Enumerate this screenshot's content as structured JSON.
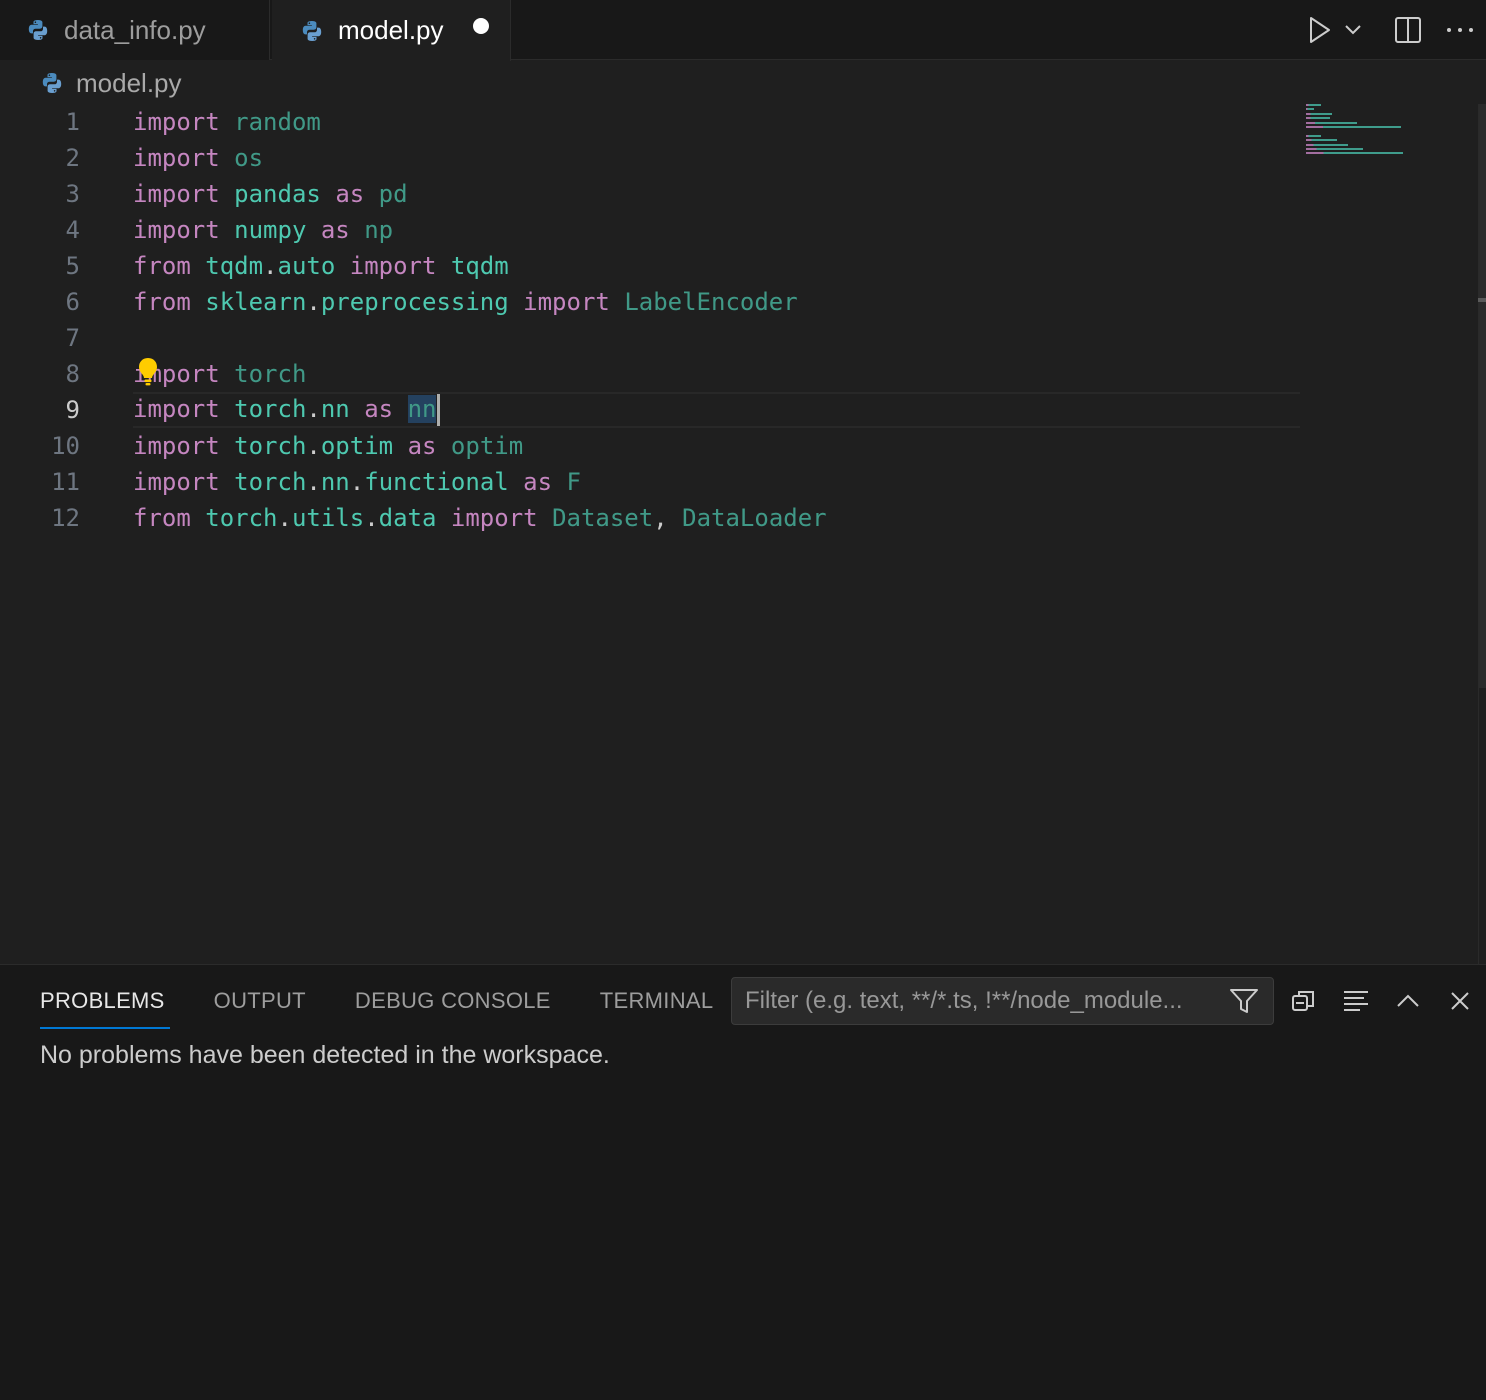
{
  "tabs": [
    {
      "label": "data_info.py",
      "active": false,
      "dirty": false
    },
    {
      "label": "model.py",
      "active": true,
      "dirty": true
    }
  ],
  "breadcrumb": {
    "file": "model.py"
  },
  "editor": {
    "current_line": 9,
    "lines": [
      {
        "n": "1"
      },
      {
        "n": "2"
      },
      {
        "n": "3"
      },
      {
        "n": "4"
      },
      {
        "n": "5"
      },
      {
        "n": "6"
      },
      {
        "n": "7"
      },
      {
        "n": "8"
      },
      {
        "n": "9"
      },
      {
        "n": "10"
      },
      {
        "n": "11"
      },
      {
        "n": "12"
      }
    ],
    "tokens": {
      "import": "import",
      "from": "from",
      "as": "as",
      "random": "random",
      "os": "os",
      "pandas": "pandas",
      "pd": "pd",
      "numpy": "numpy",
      "np": "np",
      "tqdm_auto_1": "tqdm",
      "dot": ".",
      "auto": "auto",
      "tqdm": "tqdm",
      "sklearn": "sklearn",
      "preprocessing": "preprocessing",
      "LabelEncoder": "LabelEncoder",
      "torch": "torch",
      "nn": "nn",
      "optim": "optim",
      "functional": "functional",
      "F": "F",
      "utils": "utils",
      "data": "data",
      "Dataset": "Dataset",
      "comma": ",",
      "DataLoader": "DataLoader"
    }
  },
  "panel": {
    "tabs": [
      "PROBLEMS",
      "OUTPUT",
      "DEBUG CONSOLE",
      "TERMINAL"
    ],
    "active_tab": "PROBLEMS",
    "filter_placeholder": "Filter (e.g. text, **/*.ts, !**/node_module...",
    "message": "No problems have been detected in the workspace."
  },
  "icons": {
    "run": "run-icon",
    "run_dropdown": "chevron-down-icon",
    "split": "split-editor-icon",
    "more": "more-actions-icon",
    "filter": "filter-icon",
    "collapse": "collapse-all-icon",
    "wrap": "word-wrap-icon",
    "maximize": "chevron-up-icon",
    "close": "close-icon",
    "python": "python-icon",
    "lightbulb": "lightbulb-icon"
  },
  "colors": {
    "keyword": "#c586c0",
    "module": "#4ec9b0",
    "accent": "#0078d4",
    "selection": "#264f78"
  }
}
